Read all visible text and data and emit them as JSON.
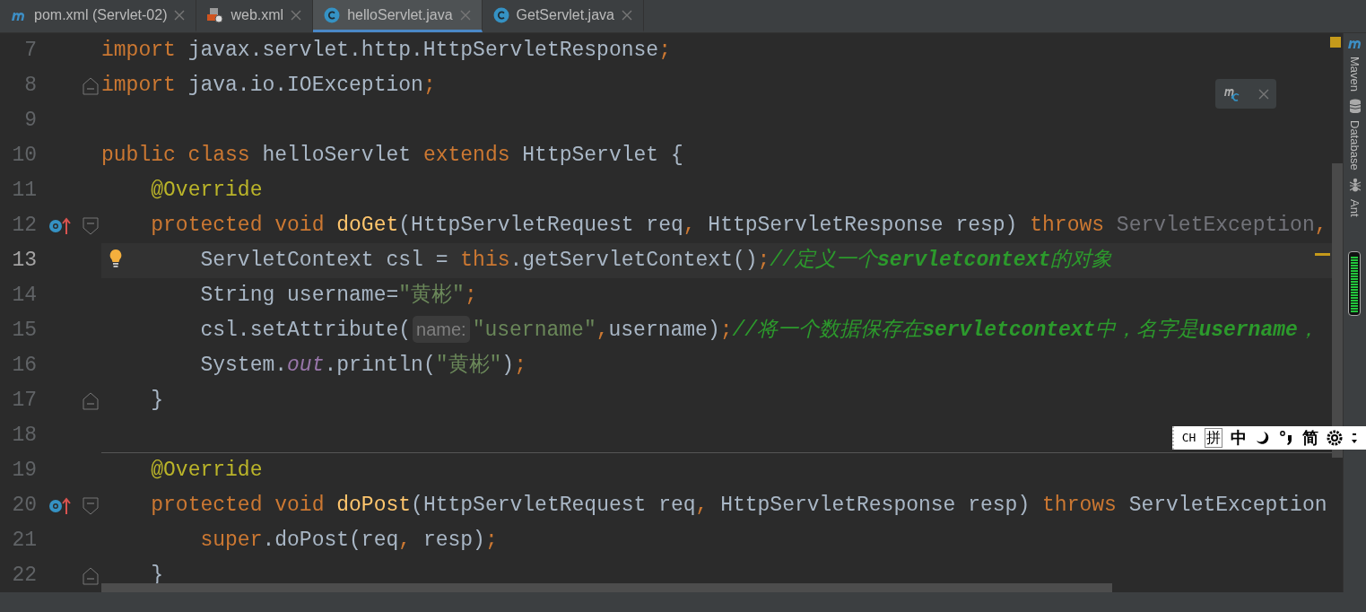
{
  "tabs": [
    {
      "label": "pom.xml (Servlet-02)",
      "kind": "maven",
      "selected": false
    },
    {
      "label": "web.xml",
      "kind": "xml",
      "selected": false
    },
    {
      "label": "helloServlet.java",
      "kind": "class",
      "selected": true
    },
    {
      "label": "GetServlet.java",
      "kind": "class",
      "selected": false
    }
  ],
  "editor": {
    "lines": [
      {
        "number": "7",
        "tokens": [
          {
            "kind": "kw",
            "text": "import"
          },
          {
            "kind": "plain",
            "text": " javax.servlet.http.HttpServletResponse"
          },
          {
            "kind": "kw",
            "text": ";"
          }
        ]
      },
      {
        "number": "8",
        "fold_end": true,
        "tokens": [
          {
            "kind": "kw",
            "text": "import"
          },
          {
            "kind": "plain",
            "text": " java.io.IOException"
          },
          {
            "kind": "kw",
            "text": ";"
          }
        ]
      },
      {
        "number": "9"
      },
      {
        "number": "10",
        "tokens": [
          {
            "kind": "kw",
            "text": "public class"
          },
          {
            "kind": "plain",
            "text": " helloServlet "
          },
          {
            "kind": "kw",
            "text": "extends"
          },
          {
            "kind": "plain",
            "text": " HttpServlet {"
          }
        ]
      },
      {
        "number": "11",
        "tokens": [
          {
            "kind": "annotation",
            "text": "    @Override"
          }
        ]
      },
      {
        "number": "12",
        "overrides": true,
        "fold_start": true,
        "tokens": [
          {
            "kind": "kw",
            "text": "    protected void "
          },
          {
            "kind": "method",
            "text": "doGet"
          },
          {
            "kind": "plain",
            "text": "(HttpServletRequest req"
          },
          {
            "kind": "kw",
            "text": ","
          },
          {
            "kind": "plain",
            "text": " HttpServletResponse resp) "
          },
          {
            "kind": "kw",
            "text": "throws "
          },
          {
            "kind": "muted",
            "text": "ServletException"
          },
          {
            "kind": "kw",
            "text": ","
          }
        ]
      },
      {
        "number": "13",
        "current": true,
        "bulb": true,
        "tokens": [
          {
            "kind": "plain",
            "text": "        ServletContext csl = "
          },
          {
            "kind": "kw",
            "text": "this"
          },
          {
            "kind": "plain",
            "text": ".getServletContext()"
          },
          {
            "kind": "kw",
            "text": ";"
          },
          {
            "kind": "comment",
            "text": "//定义一个**servletcontext**的对象"
          }
        ]
      },
      {
        "number": "14",
        "tokens": [
          {
            "kind": "plain",
            "text": "        String username="
          },
          {
            "kind": "string",
            "text": "\"黄彬\""
          },
          {
            "kind": "kw",
            "text": ";"
          }
        ]
      },
      {
        "number": "15",
        "tokens": [
          {
            "kind": "plain",
            "text": "        csl.setAttribute("
          },
          {
            "kind": "hint",
            "text": "name:"
          },
          {
            "kind": "string",
            "text": "\"username\""
          },
          {
            "kind": "kw",
            "text": ","
          },
          {
            "kind": "plain",
            "text": "username)"
          },
          {
            "kind": "kw",
            "text": ";"
          },
          {
            "kind": "comment",
            "text": "//将一个数据保存在**servletcontext**中，名字是**username**，"
          }
        ]
      },
      {
        "number": "16",
        "tokens": [
          {
            "kind": "plain",
            "text": "        System."
          },
          {
            "kind": "field",
            "text": "out"
          },
          {
            "kind": "plain",
            "text": ".println("
          },
          {
            "kind": "string",
            "text": "\"黄彬\""
          },
          {
            "kind": "plain",
            "text": ")"
          },
          {
            "kind": "kw",
            "text": ";"
          }
        ]
      },
      {
        "number": "17",
        "fold_end": true,
        "tokens": [
          {
            "kind": "plain",
            "text": "    }"
          }
        ]
      },
      {
        "number": "18",
        "separator": true
      },
      {
        "number": "19",
        "tokens": [
          {
            "kind": "annotation",
            "text": "    @Override"
          }
        ]
      },
      {
        "number": "20",
        "overrides": true,
        "fold_start": true,
        "tokens": [
          {
            "kind": "kw",
            "text": "    protected void "
          },
          {
            "kind": "method",
            "text": "doPost"
          },
          {
            "kind": "plain",
            "text": "(HttpServletRequest req"
          },
          {
            "kind": "kw",
            "text": ","
          },
          {
            "kind": "plain",
            "text": " HttpServletResponse resp) "
          },
          {
            "kind": "kw",
            "text": "throws"
          },
          {
            "kind": "plain",
            "text": " ServletException"
          }
        ]
      },
      {
        "number": "21",
        "tokens": [
          {
            "kind": "kw",
            "text": "        super"
          },
          {
            "kind": "plain",
            "text": ".doPost(req"
          },
          {
            "kind": "kw",
            "text": ","
          },
          {
            "kind": "plain",
            "text": " resp)"
          },
          {
            "kind": "kw",
            "text": ";"
          }
        ]
      },
      {
        "number": "22",
        "fold_end": true,
        "tokens": [
          {
            "kind": "plain",
            "text": "    }"
          }
        ]
      }
    ]
  },
  "sidebar": {
    "items": [
      {
        "label": "Maven",
        "kind": "maven"
      },
      {
        "label": "Database",
        "kind": "database"
      },
      {
        "label": "Ant",
        "kind": "ant"
      }
    ],
    "memory_indicator": {
      "level": 0.95
    }
  },
  "ime_toolbar": {
    "items": [
      {
        "kind": "text",
        "text": "CH"
      },
      {
        "kind": "boxed",
        "text": "拼"
      },
      {
        "kind": "text",
        "text": "中"
      },
      {
        "kind": "moon"
      },
      {
        "kind": "punctuation"
      },
      {
        "kind": "text",
        "text": "简"
      },
      {
        "kind": "gear"
      },
      {
        "kind": "more"
      }
    ]
  }
}
